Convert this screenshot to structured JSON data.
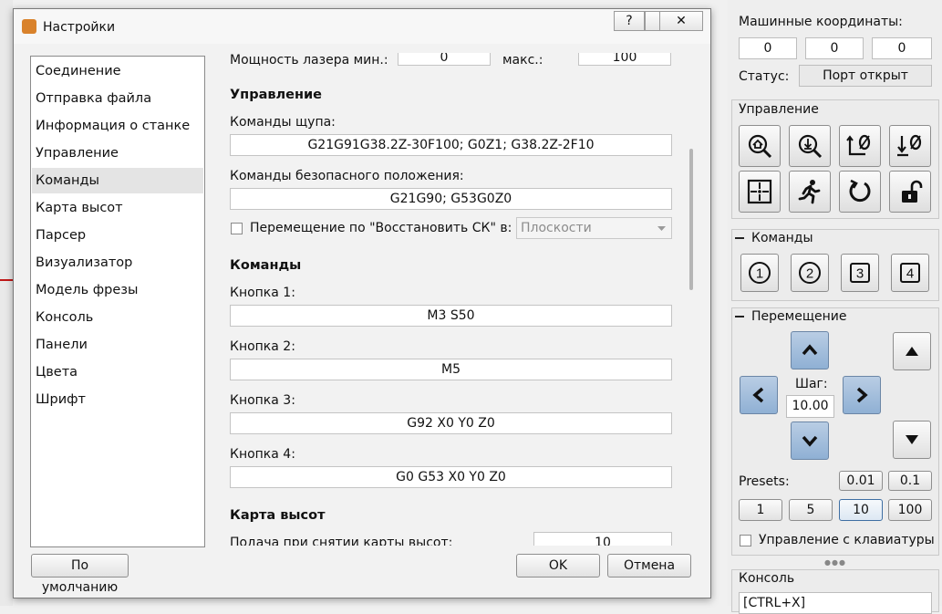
{
  "dialog": {
    "title": "Настройки",
    "help_label": "?",
    "close_label": "✕",
    "nav": [
      "Соединение",
      "Отправка файла",
      "Информация о станке",
      "Управление",
      "Команды",
      "Карта высот",
      "Парсер",
      "Визуализатор",
      "Модель фрезы",
      "Консоль",
      "Панели",
      "Цвета",
      "Шрифт"
    ],
    "selected_nav": "Команды",
    "laser_min_label": "Мощность лазера мин.:",
    "laser_min_value": "0",
    "laser_max_label": "макс.:",
    "laser_max_value": "100",
    "section_control": "Управление",
    "probe_label": "Команды щупа:",
    "probe_value": "G21G91G38.2Z-30F100; G0Z1; G38.2Z-2F10",
    "safe_label": "Команды безопасного положения:",
    "safe_value": "G21G90; G53G0Z0",
    "restore_label": "Перемещение по \"Восстановить СК\" в:",
    "restore_option": "Плоскости",
    "section_commands": "Команды",
    "buttons": [
      {
        "label": "Кнопка 1:",
        "value": "M3 S50"
      },
      {
        "label": "Кнопка 2:",
        "value": "M5"
      },
      {
        "label": "Кнопка 3:",
        "value": "G92 X0 Y0 Z0"
      },
      {
        "label": "Кнопка 4:",
        "value": "G0 G53 X0 Y0 Z0"
      }
    ],
    "section_heightmap": "Карта высот",
    "heightmap_feed_label": "Подача при снятии карты высот:",
    "heightmap_feed_value": "10",
    "defaults_button": "По умолчанию",
    "ok_button": "OK",
    "cancel_button": "Отмена"
  },
  "panel": {
    "machine_coords_label": "Машинные координаты:",
    "coords": [
      "0",
      "0",
      "0"
    ],
    "status_label": "Статус:",
    "status_value": "Порт открыт",
    "control_title": "Управление",
    "commands_title": "Команды",
    "command_buttons": [
      "1",
      "2",
      "3",
      "4"
    ],
    "move_title": "Перемещение",
    "step_label": "Шаг:",
    "step_value": "10.00",
    "presets_label": "Presets:",
    "presets_top": [
      "0.01",
      "0.1"
    ],
    "presets_bottom": [
      "1",
      "5",
      "10",
      "100"
    ],
    "keyboard_label": "Управление с клавиатуры",
    "console_title": "Консоль",
    "console_hint": "[CTRL+X]",
    "dots": "●●●"
  },
  "colors": {
    "accent": "#8fb0d4",
    "dialog_bg": "#f2f2f2",
    "selected": "#e4e4e4"
  }
}
